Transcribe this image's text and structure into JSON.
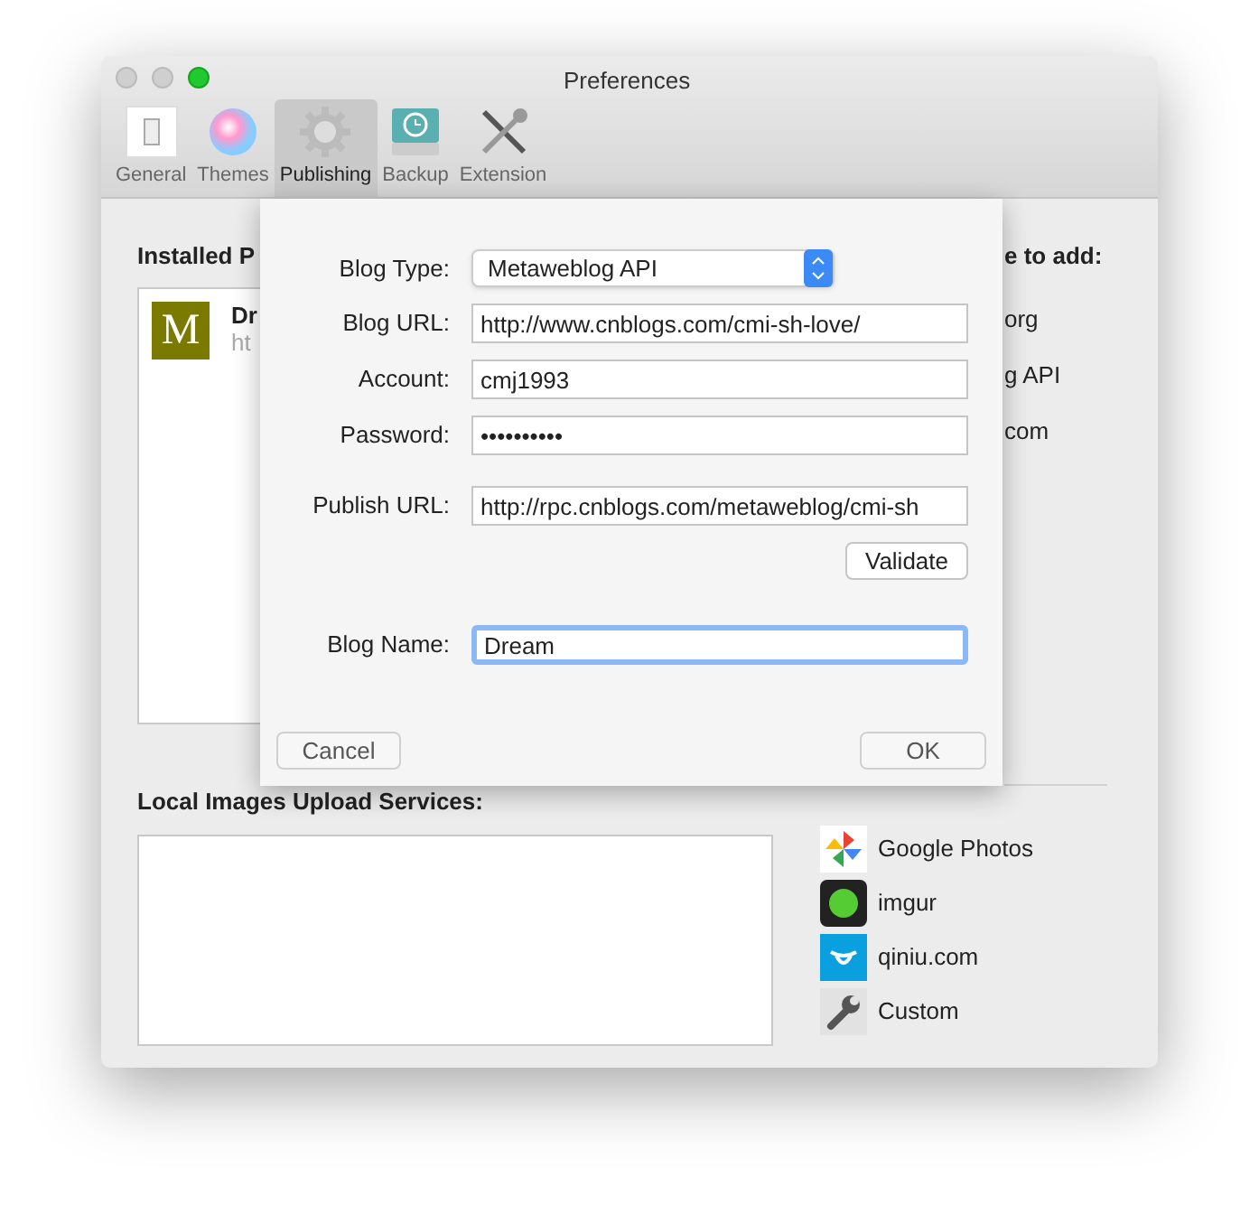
{
  "window": {
    "title": "Preferences"
  },
  "toolbar": [
    {
      "label": "General",
      "kind": "general",
      "selected": false
    },
    {
      "label": "Themes",
      "kind": "themes",
      "selected": false
    },
    {
      "label": "Publishing",
      "kind": "publishing",
      "selected": true
    },
    {
      "label": "Backup",
      "kind": "backup",
      "selected": false
    },
    {
      "label": "Extension",
      "kind": "extension",
      "selected": false
    }
  ],
  "installed": {
    "heading": "Installed P",
    "items": [
      {
        "icon": "M",
        "name": "Dr",
        "url": "ht"
      }
    ]
  },
  "available": {
    "heading": "e to add:",
    "items": [
      "org",
      "g API",
      "com"
    ]
  },
  "local": {
    "heading": "Local Images Upload Services:",
    "services": [
      {
        "name": "Google Photos",
        "kind": "pinwheel"
      },
      {
        "name": "imgur",
        "kind": "dot"
      },
      {
        "name": "qiniu.com",
        "kind": "bull"
      },
      {
        "name": "Custom",
        "kind": "wrench"
      }
    ]
  },
  "sheet": {
    "fields": [
      {
        "kind": "select",
        "label": "Blog Type:",
        "value": "Metaweblog API"
      },
      {
        "kind": "text",
        "label": "Blog URL:",
        "value": "http://www.cnblogs.com/cmi-sh-love/",
        "focused": false
      },
      {
        "kind": "text",
        "label": "Account:",
        "value": "cmj1993",
        "focused": false
      },
      {
        "kind": "text",
        "label": "Password:",
        "value": "••••••••••",
        "focused": false
      },
      {
        "kind": "text",
        "label": "Publish URL:",
        "value": "http://rpc.cnblogs.com/metaweblog/cmi-sh",
        "focused": false
      },
      {
        "kind": "button",
        "label": "Validate"
      },
      {
        "kind": "text",
        "label": "Blog Name:",
        "value": "Dream",
        "focused": true
      }
    ],
    "cancel": "Cancel",
    "ok": "OK"
  }
}
